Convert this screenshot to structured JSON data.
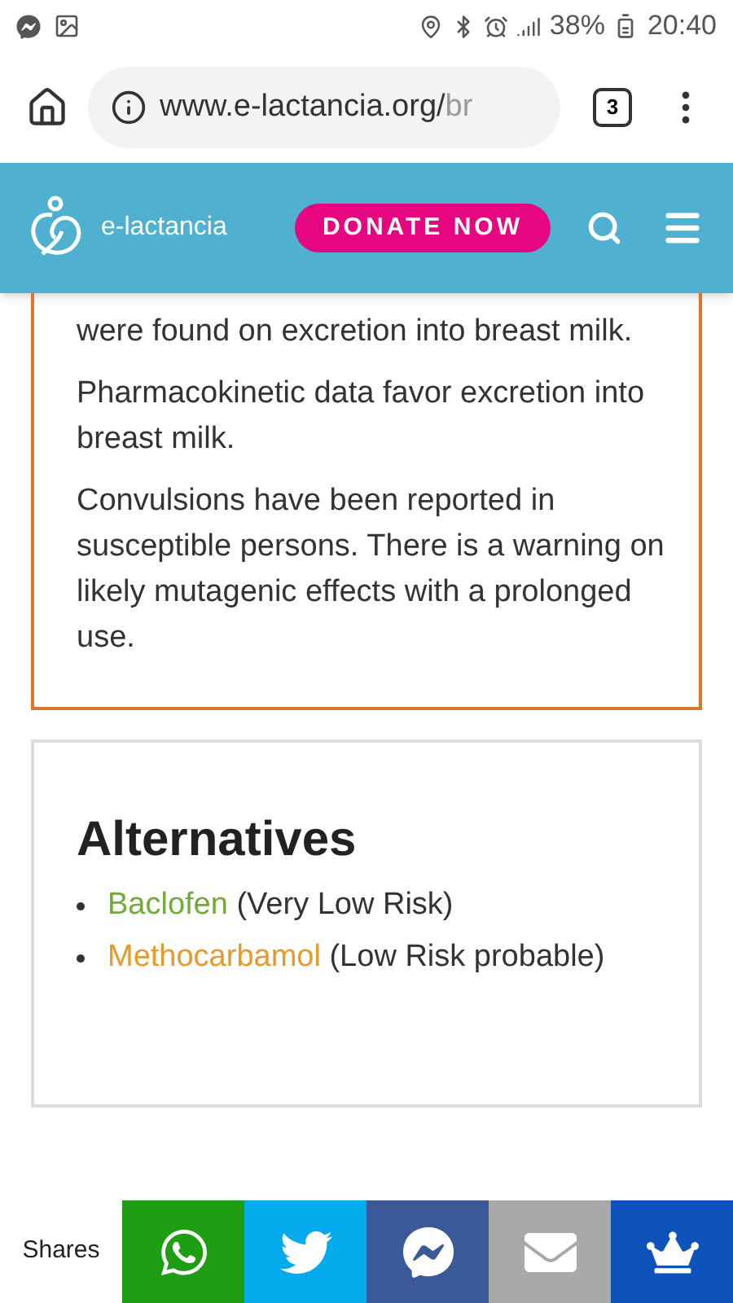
{
  "status_bar": {
    "battery": "38%",
    "time": "20:40"
  },
  "browser": {
    "url_host": "www.e-lactancia.org/",
    "url_path": "br",
    "tab_count": "3"
  },
  "header": {
    "site_name": "e-lactancia",
    "donate": "DONATE NOW"
  },
  "summary": {
    "paragraphs": [
      "were found on excretion into breast milk.",
      "Pharmacokinetic data favor excretion into breast milk.",
      "Convulsions have been reported in susceptible persons. There is a warning on likely mutagenic effects with a prolonged use."
    ]
  },
  "alternatives": {
    "title": "Alternatives",
    "items": [
      {
        "name": "Baclofen",
        "risk": "(Very Low Risk)",
        "color": "#72ab3a"
      },
      {
        "name": "Methocarbamol",
        "risk": "(Low Risk probable)",
        "color": "#e49b2b"
      }
    ]
  },
  "share_bar": {
    "label": "Shares",
    "buttons": [
      {
        "kind": "whatsapp",
        "color": "#1f9e14"
      },
      {
        "kind": "twitter",
        "color": "#03abec"
      },
      {
        "kind": "messenger",
        "color": "#3b5998"
      },
      {
        "kind": "email",
        "color": "#a9a9a9"
      },
      {
        "kind": "crown",
        "color": "#0e53bb"
      }
    ]
  }
}
